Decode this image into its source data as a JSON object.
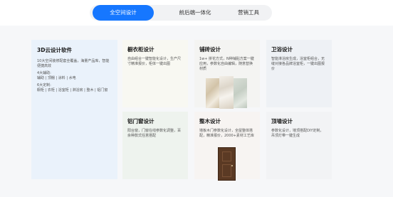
{
  "tabs": [
    {
      "label": "全空间设计",
      "active": true
    },
    {
      "label": "前后端一体化",
      "active": false
    },
    {
      "label": "营销工具",
      "active": false
    }
  ],
  "main_panel": {
    "title": "3D云设计软件",
    "description": "10大空间装修配套全覆盖，海量产品库，智能便捷高效",
    "tools_heading": "4大辅助:",
    "tools": "辅助 | 顶棚 | 涂料 | 水电",
    "libs_heading": "6大定制:",
    "libs": "橱柜 | 衣柜 | 浴室柜 | 淋浴房 | 整木 | 铝门窗"
  },
  "cards": [
    {
      "id": "wardrobe",
      "title": "橱衣柜设计",
      "description": "自由组合一键智能化设计，生产尺寸精准报价，柜体一键出图"
    },
    {
      "id": "tile",
      "title": "铺砖设计",
      "description": "1w+ 拼花方式，N种铺贴方案一键应用，参数化自由编辑，随意替换材质"
    },
    {
      "id": "bath",
      "title": "卫浴设计",
      "description": "智能淋浴房生成，浴室柜组合，无缝对接各品牌浴室柜，一键出图报价"
    },
    {
      "id": "window",
      "title": "铝门窗设计",
      "description": "阳台窗，门窗在线参数化调整，百余种款式任意搭配"
    },
    {
      "id": "wood",
      "title": "整木设计",
      "description": "墙板木门参数化设计，全屋整体搭配，精准报价，2000+素材工艺库"
    },
    {
      "id": "ceiling",
      "title": "顶墙设计",
      "description": "参数化设计，墙顶搭配DIY定制，吊顶灯带一键生成"
    }
  ],
  "colors": {
    "accent": "#1677ff",
    "tab_bar_bg": "#f1f2f4",
    "stage_bg": "#f6f7f9",
    "main_panel_bg": "#eaf2fb",
    "door_wood": "#5b3a24"
  }
}
